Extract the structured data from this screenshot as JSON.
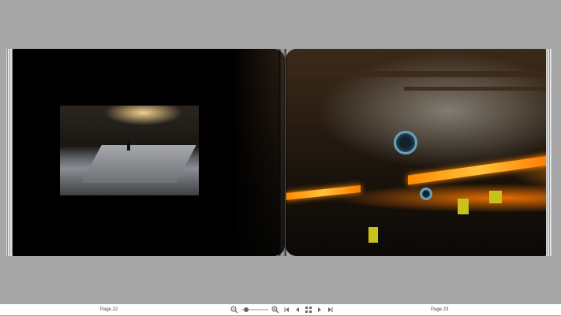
{
  "viewer": {
    "left_page_label": "Page 22",
    "right_page_label": "Page 23",
    "zoom_level": 0.1
  },
  "controls": {
    "zoom_out_icon": "magnifier-minus-icon",
    "zoom_in_icon": "magnifier-plus-icon",
    "first_page_icon": "first-page-icon",
    "prev_page_icon": "previous-page-icon",
    "grid_view_icon": "grid-view-icon",
    "next_page_icon": "next-page-icon",
    "last_page_icon": "last-page-icon"
  },
  "colors": {
    "background": "#a6a6a6",
    "toolbar": "#ffffff",
    "page_label": "#444444"
  }
}
